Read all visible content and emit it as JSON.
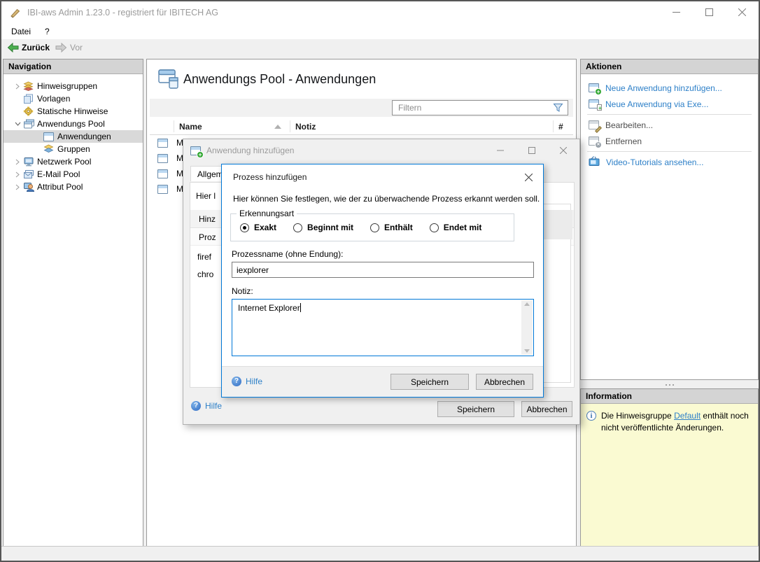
{
  "colors": {
    "link_blue": "#2E80C8",
    "focus_blue": "#0078D7",
    "info_bg": "#FAFAD2",
    "back_green": "#3F9C35"
  },
  "window": {
    "title": "IBI-aws Admin 1.23.0 - registriert für IBITECH AG"
  },
  "menu": {
    "datei": "Datei",
    "help": "?"
  },
  "toolbar": {
    "back": "Zurück",
    "forward": "Vor"
  },
  "icons": {
    "help_glyph": "?",
    "info_glyph": "i"
  },
  "navigation": {
    "header": "Navigation",
    "items": [
      {
        "label": "Hinweisgruppen"
      },
      {
        "label": "Vorlagen"
      },
      {
        "label": "Statische Hinweise"
      },
      {
        "label": "Anwendungs Pool"
      },
      {
        "label": "Anwendungen"
      },
      {
        "label": "Gruppen"
      },
      {
        "label": "Netzwerk Pool"
      },
      {
        "label": "E-Mail Pool"
      },
      {
        "label": "Attribut Pool"
      }
    ]
  },
  "main": {
    "title": "Anwendungs Pool - Anwendungen",
    "filter": {
      "placeholder": "Filtern"
    },
    "table": {
      "col_name": "Name",
      "col_notiz": "Notiz",
      "col_count": "#",
      "rows": [
        {
          "name": "M"
        },
        {
          "name": "M"
        },
        {
          "name": "M"
        },
        {
          "name": "M"
        }
      ]
    }
  },
  "actions": {
    "header": "Aktionen",
    "add": "Neue Anwendung hinzufügen...",
    "add_exe": "Neue Anwendung via Exe...",
    "edit": "Bearbeiten...",
    "remove": "Entfernen",
    "video": "Video-Tutorials ansehen..."
  },
  "information": {
    "header": "Information",
    "before": "Die Hinweisgruppe ",
    "link": "Default",
    "after": " enthält noch nicht veröffentlichte Änderungen."
  },
  "outer_dialog": {
    "title": "Anwendung hinzufügen",
    "tab": "Allgem",
    "desc_clip": "Hier l",
    "toolbar_clip": "Hinz",
    "colhdr_clip": "Proz",
    "row1_clip": "firef",
    "row2_clip": "chro",
    "help": "Hilfe",
    "save": "Speichern",
    "cancel": "Abbrechen"
  },
  "process_dialog": {
    "title": "Prozess hinzufügen",
    "description": "Hier können Sie festlegen, wie der zu überwachende Prozess erkannt werden soll.",
    "group": "Erkennungsart",
    "radio_exact": "Exakt",
    "radio_begins": "Beginnt mit",
    "radio_contains": "Enthält",
    "radio_ends": "Endet mit",
    "name_label": "Prozessname (ohne Endung):",
    "name_value": "iexplorer",
    "note_label": "Notiz:",
    "note_value": "Internet Explorer",
    "help": "Hilfe",
    "save": "Speichern",
    "cancel": "Abbrechen"
  }
}
